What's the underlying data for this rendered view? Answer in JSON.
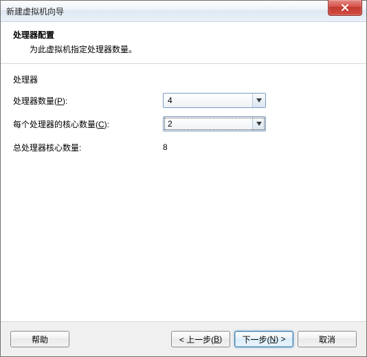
{
  "window": {
    "title": "新建虚拟机向导"
  },
  "header": {
    "title": "处理器配置",
    "desc": "为此虚拟机指定处理器数量。"
  },
  "form": {
    "group_label": "处理器",
    "processors": {
      "label_prefix": "处理器数量(",
      "label_hotkey": "P",
      "label_suffix": "):",
      "value": "4"
    },
    "cores": {
      "label_prefix": "每个处理器的核心数量(",
      "label_hotkey": "C",
      "label_suffix": "):",
      "value": "2"
    },
    "total": {
      "label": "总处理器核心数量:",
      "value": "8"
    }
  },
  "buttons": {
    "help": "帮助",
    "back_prefix": "< 上一步(",
    "back_hotkey": "B",
    "back_suffix": ")",
    "next_prefix": "下一步(",
    "next_hotkey": "N",
    "next_suffix": ") >",
    "cancel": "取消"
  }
}
